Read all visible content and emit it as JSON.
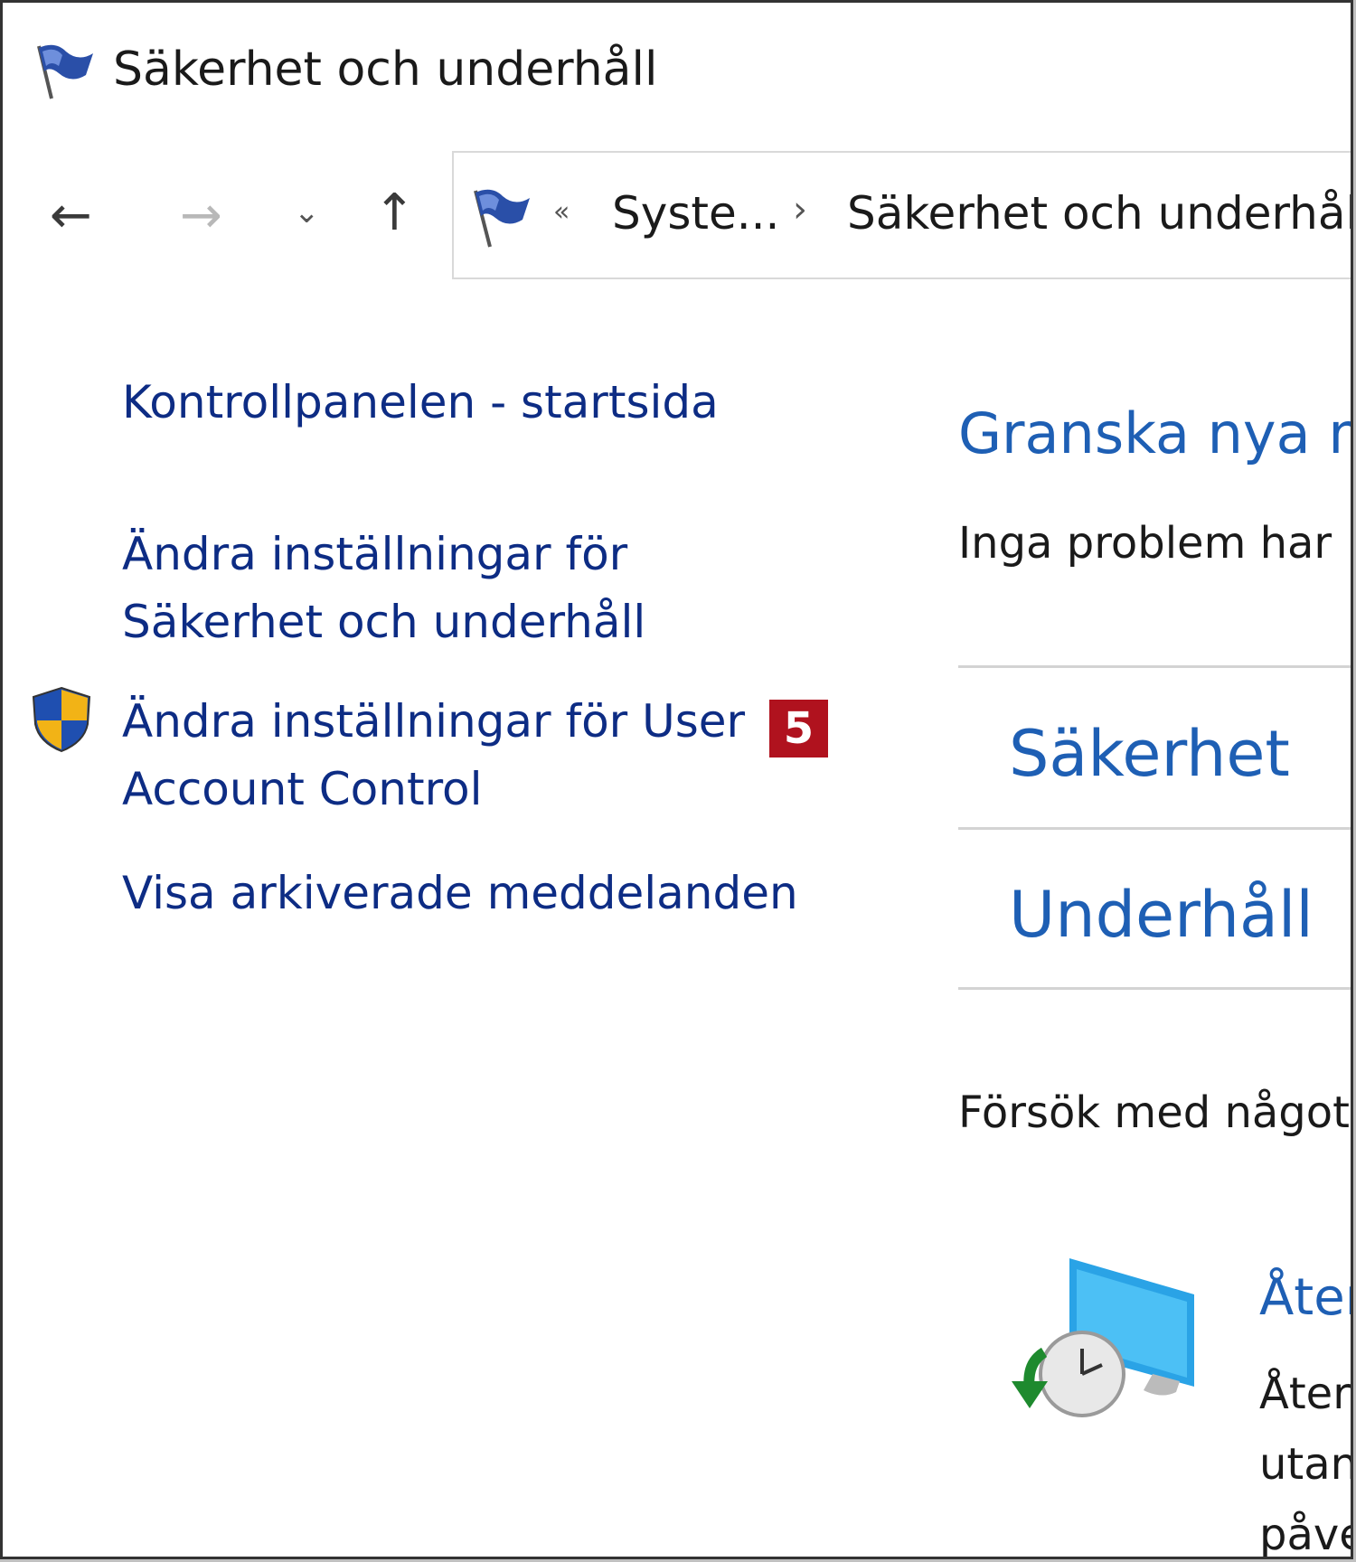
{
  "window": {
    "title": "Säkerhet och underhåll",
    "title_icon": "flag-icon"
  },
  "navigation": {
    "back_glyph": "←",
    "forward_glyph": "→",
    "recent_glyph": "⌄",
    "up_glyph": "↑"
  },
  "address_bar": {
    "icon": "flag-icon",
    "overflow_glyph": "«",
    "separator_glyph": "›",
    "breadcrumbs": [
      "Syste...",
      "Säkerhet och underhåll"
    ]
  },
  "sidebar": {
    "links": [
      {
        "label": "Kontrollpanelen - startsida"
      },
      {
        "label_line1": "Ändra inställningar för",
        "label_line2": "Säkerhet och underhåll"
      },
      {
        "label_line1": "Ändra inställningar för User",
        "label_line2": "Account Control",
        "icon": "uac-shield-icon"
      },
      {
        "label": "Visa arkiverade meddelanden"
      }
    ],
    "badge_number": "5"
  },
  "main": {
    "heading": "Granska nya m",
    "status": "Inga problem har",
    "sections": [
      {
        "label": "Säkerhet"
      },
      {
        "label": "Underhåll"
      }
    ],
    "try_text": "Försök med något",
    "restore": {
      "icon": "system-restore-icon",
      "link": "Åters",
      "desc_lines": [
        "Åters",
        "utan",
        "påve"
      ]
    }
  },
  "colors": {
    "link_dark": "#0d2c84",
    "link_blue": "#1e5fb4",
    "badge_red": "#b0121e"
  }
}
